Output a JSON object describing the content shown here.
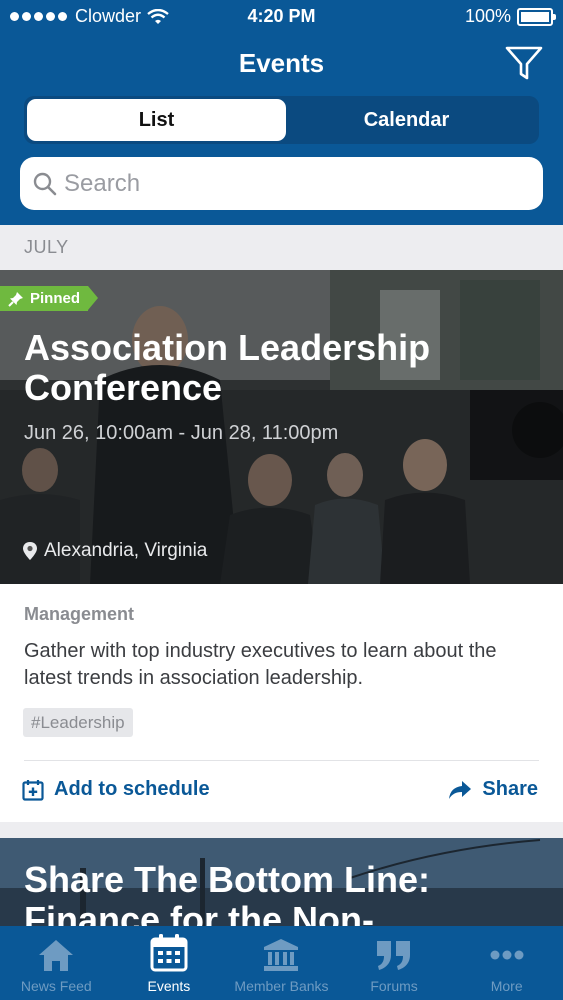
{
  "status_bar": {
    "carrier": "Clowder",
    "time": "4:20 PM",
    "battery": "100%"
  },
  "nav": {
    "title": "Events"
  },
  "segments": {
    "list": "List",
    "calendar": "Calendar",
    "selected": "List"
  },
  "search": {
    "placeholder": "Search"
  },
  "section": {
    "label": "JULY"
  },
  "event": {
    "badge": "Pinned",
    "title": "Association Leadership Conference",
    "dates": "Jun 26, 10:00am - Jun 28, 11:00pm",
    "location": "Alexandria, Virginia",
    "category": "Management",
    "description": "Gather with top industry executives to learn about the latest trends in association leadership.",
    "tag": "#Leadership",
    "add_label": "Add to schedule",
    "share_label": "Share"
  },
  "event2": {
    "title": "Share The Bottom Line: Finance for the Non-"
  },
  "tabs": [
    {
      "label": "News Feed",
      "icon": "home-icon"
    },
    {
      "label": "Events",
      "icon": "calendar-icon"
    },
    {
      "label": "Member Banks",
      "icon": "bank-icon"
    },
    {
      "label": "Forums",
      "icon": "quote-icon"
    },
    {
      "label": "More",
      "icon": "more-icon"
    }
  ],
  "colors": {
    "brand": "#0a5897",
    "pinned": "#6fb93f",
    "tab_inactive": "#6e9bc2"
  }
}
